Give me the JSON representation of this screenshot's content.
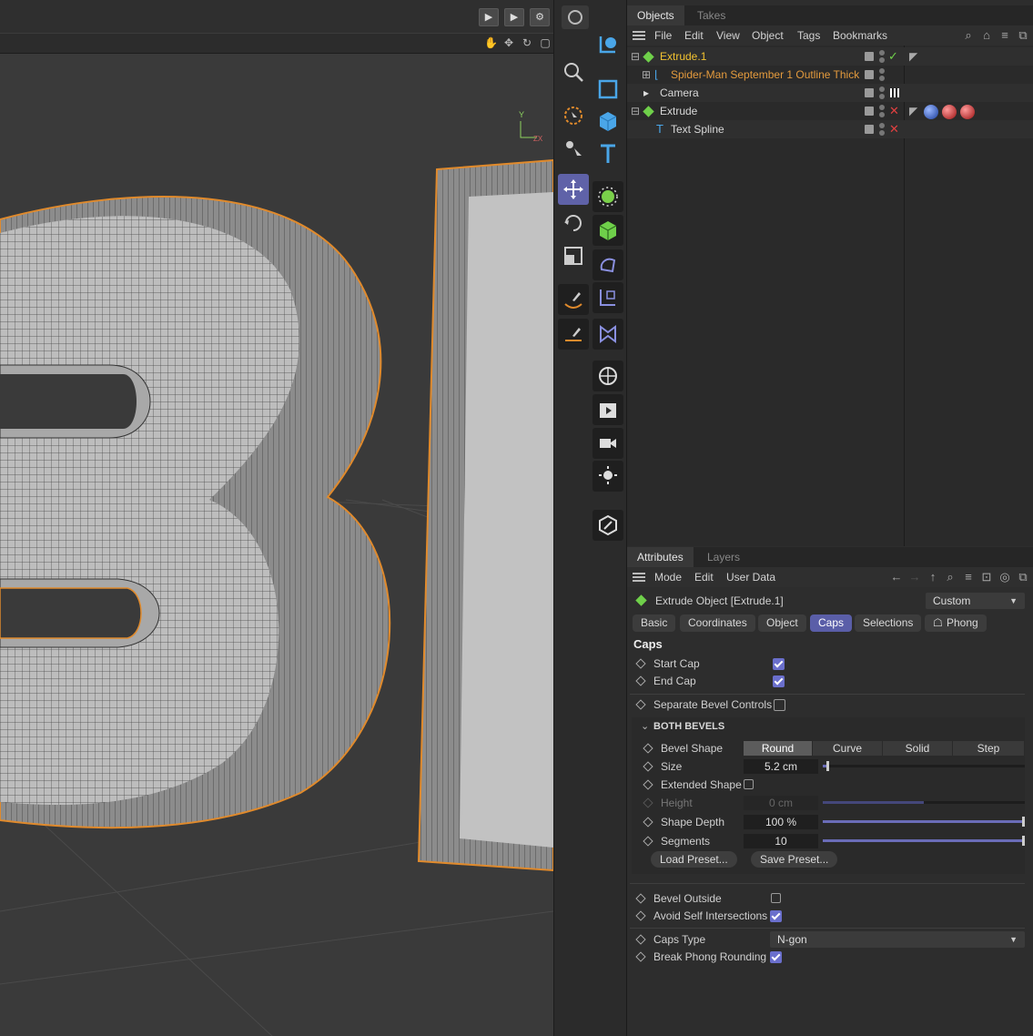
{
  "objects_panel": {
    "tabs": [
      "Objects",
      "Takes"
    ],
    "menu": [
      "File",
      "Edit",
      "View",
      "Object",
      "Tags",
      "Bookmarks"
    ],
    "rows": [
      {
        "name": "Extrude.1",
        "color": "#f2c230",
        "expand": "−",
        "icon": "extrude-icon",
        "status": "check"
      },
      {
        "name": "Spider-Man September 1 Outline Thick",
        "color": "#e39a3d",
        "expand": "+",
        "icon": "spline-icon",
        "status": "none"
      },
      {
        "name": "Camera",
        "color": "#d8d8d8",
        "expand": "",
        "icon": "camera-icon",
        "status": "none"
      },
      {
        "name": "Extrude",
        "color": "#d8d8d8",
        "expand": "−",
        "icon": "extrude-icon",
        "status": "cross"
      },
      {
        "name": "Text Spline",
        "color": "#d8d8d8",
        "expand": "",
        "icon": "text-icon",
        "status": "cross"
      }
    ]
  },
  "attributes_panel": {
    "tabs": [
      "Attributes",
      "Layers"
    ],
    "menu": [
      "Mode",
      "Edit",
      "User Data"
    ],
    "object_title": "Extrude Object [Extrude.1]",
    "preset": "Custom",
    "subtabs": [
      "Basic",
      "Coordinates",
      "Object",
      "Caps",
      "Selections",
      "Phong"
    ],
    "section_title": "Caps",
    "start_cap": "Start Cap",
    "end_cap": "End Cap",
    "separate_bevel": "Separate Bevel Controls",
    "both_bevels": "BOTH BEVELS",
    "bevel_shape": "Bevel Shape",
    "bevel_shape_options": [
      "Round",
      "Curve",
      "Solid",
      "Step"
    ],
    "size_label": "Size",
    "size_value": "5.2 cm",
    "size_fraction": 0.03,
    "extended_shape": "Extended Shape",
    "height_label": "Height",
    "height_value": "0 cm",
    "height_fraction": 0.5,
    "shape_depth_label": "Shape Depth",
    "shape_depth_value": "100 %",
    "shape_depth_fraction": 1.0,
    "segments_label": "Segments",
    "segments_value": "10",
    "segments_fraction": 1.0,
    "load_preset": "Load Preset...",
    "save_preset": "Save Preset...",
    "bevel_outside": "Bevel Outside",
    "avoid_self": "Avoid Self Intersections",
    "caps_type_label": "Caps Type",
    "caps_type_value": "N-gon",
    "break_phong": "Break Phong Rounding"
  },
  "colors": {
    "accent": "#5a5ea8",
    "checkbox": "#6a6fcc",
    "selection_orange": "#e08a2c",
    "active_object": "#f2c230"
  }
}
